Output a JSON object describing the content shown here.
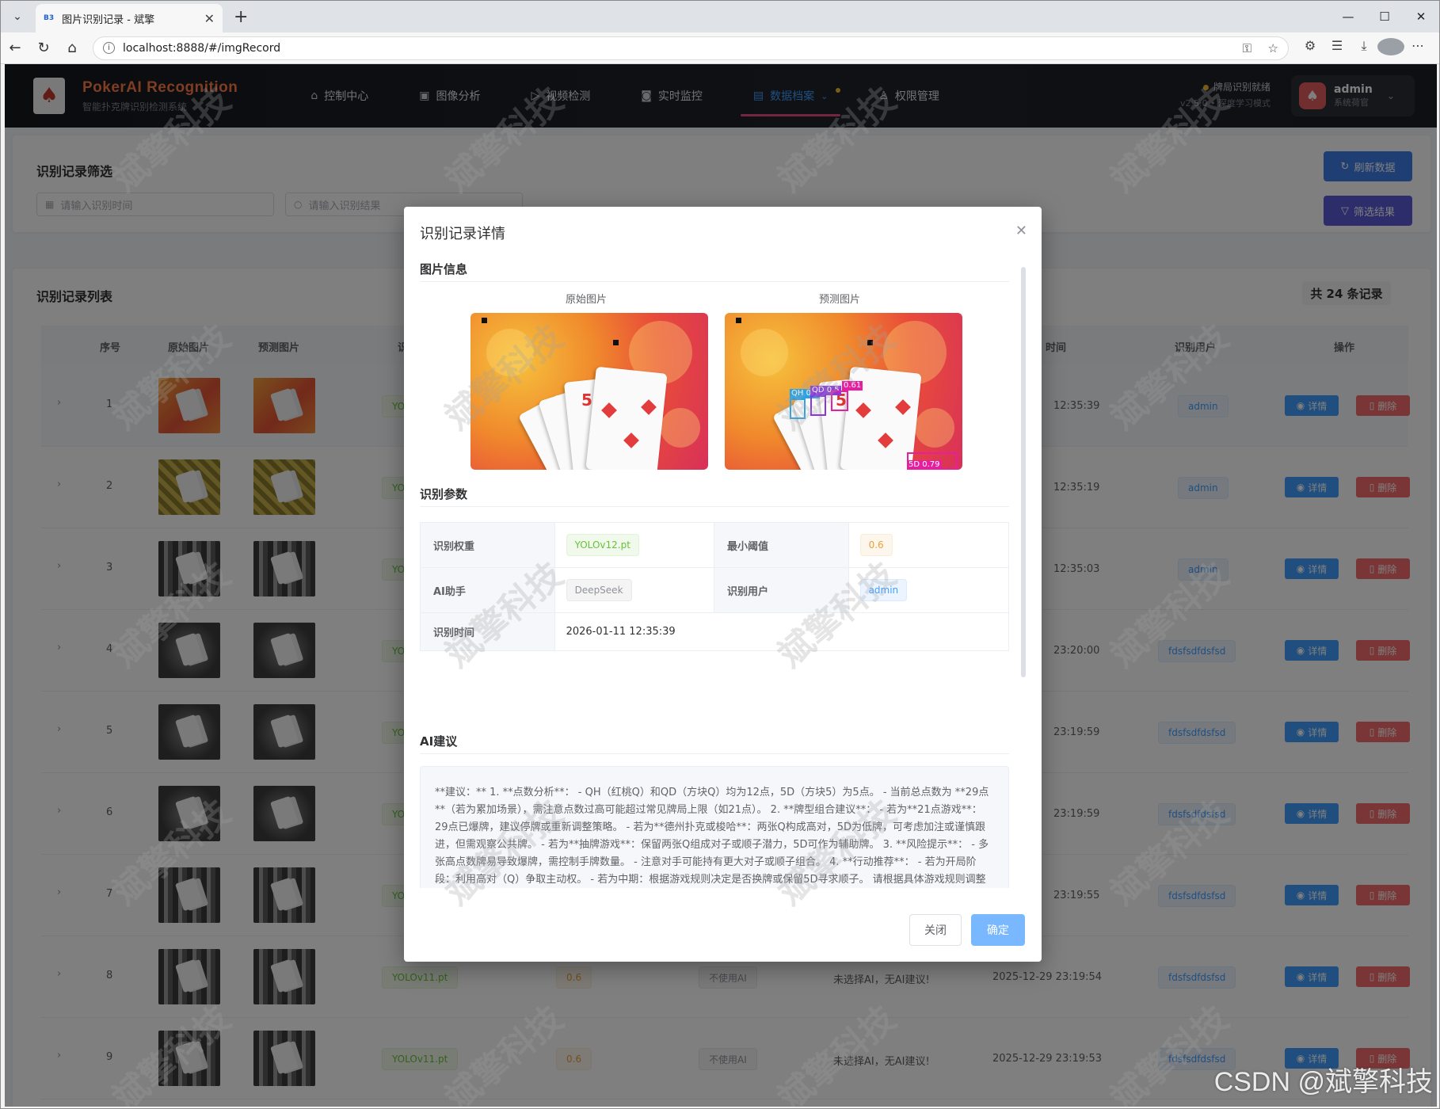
{
  "browser": {
    "tab_title": "图片识别记录 - 斌擎",
    "favicon_text": "B3",
    "url": "localhost:8888/#/imgRecord",
    "window_controls": [
      "minimize-icon",
      "maximize-icon",
      "close-icon"
    ]
  },
  "header": {
    "brand_title": "PokerAI Recognition",
    "brand_subtitle": "智能扑克牌识别检测系统",
    "nav": [
      {
        "label": "控制中心",
        "icon": "home-icon"
      },
      {
        "label": "图像分析",
        "icon": "image-icon"
      },
      {
        "label": "视频检测",
        "icon": "play-icon"
      },
      {
        "label": "实时监控",
        "icon": "camera-icon"
      },
      {
        "label": "数据档案",
        "icon": "document-icon",
        "active": true
      },
      {
        "label": "权限管理",
        "icon": "user-icon"
      }
    ],
    "status_text": "牌局识别就绪",
    "version_text": "v2.5.0 • 深度学习模式",
    "user_name": "admin",
    "user_role": "系统荷官"
  },
  "filter": {
    "title": "识别记录筛选",
    "time_placeholder": "请输入识别时间",
    "result_placeholder": "请输入识别结果",
    "refresh_label": "刷新数据",
    "filter_label": "筛选结果"
  },
  "list": {
    "title": "识别记录列表",
    "count_label": "共 24 条记录",
    "headers": [
      "序号",
      "原始图片",
      "预测图片",
      "识别",
      "时间",
      "识别用户",
      "操作"
    ],
    "detail_label": "详情",
    "delete_label": "删除",
    "rows": [
      {
        "index": "1",
        "weight": "YOLO",
        "time": "12:35:39",
        "user": "admin",
        "style": "warm"
      },
      {
        "index": "2",
        "weight": "YOLO",
        "time": "12:35:19",
        "user": "admin",
        "style": "olive"
      },
      {
        "index": "3",
        "weight": "YOLO",
        "time": "12:35:03",
        "user": "admin",
        "style": "gray"
      },
      {
        "index": "4",
        "weight": "YOLO",
        "time": "23:20:00",
        "user": "fdsfsdfdsfsd",
        "style": "dark"
      },
      {
        "index": "5",
        "weight": "YOLO",
        "time": "23:19:59",
        "user": "fdsfsdfdsfsd",
        "style": "dark"
      },
      {
        "index": "6",
        "weight": "YOLO",
        "time": "23:19:59",
        "user": "fdsfsdfdsfsd",
        "style": "dark"
      },
      {
        "index": "7",
        "weight": "YOLO",
        "time": "23:19:55",
        "user": "fdsfsdfdsfsd",
        "style": "gray"
      },
      {
        "index": "8",
        "weight": "YOLOv11.pt",
        "conf": "0.6",
        "ai": "不使用AI",
        "advice": "未选择AI，无AI建议!",
        "time": "2025-12-29 23:19:54",
        "user": "fdsfsdfdsfsd",
        "style": "gray"
      },
      {
        "index": "9",
        "weight": "YOLOv11.pt",
        "conf": "0.6",
        "ai": "不使用AI",
        "advice": "未选择AI，无AI建议!",
        "time": "2025-12-29 23:19:53",
        "user": "fdsfsdfdsfsd",
        "style": "gray"
      }
    ]
  },
  "dialog": {
    "title": "识别记录详情",
    "section_image": "图片信息",
    "original_caption": "原始图片",
    "predicted_caption": "预测图片",
    "detections": [
      {
        "label": "5D 0.79",
        "color": "#e81ea0"
      },
      {
        "label": "QH 0.5",
        "color": "#27a4e8"
      },
      {
        "label": "QD 0.5",
        "color": "#8a35e0"
      },
      {
        "label": "0.61",
        "color": "#e81ea0"
      }
    ],
    "section_params": "识别参数",
    "params": {
      "weight_label": "识别权重",
      "weight_value": "YOLOv12.pt",
      "conf_label": "最小阈值",
      "conf_value": "0.6",
      "ai_label": "AI助手",
      "ai_value": "DeepSeek",
      "user_label": "识别用户",
      "user_value": "admin",
      "time_label": "识别时间",
      "time_value": "2026-01-11 12:35:39"
    },
    "section_ai": "AI建议",
    "advice_text": "**建议：** 1. **点数分析**： - QH（红桃Q）和QD（方块Q）均为12点，5D（方块5）为5点。 - 当前总点数为 **29点**（若为累加场景），需注意点数过高可能超过常见牌局上限（如21点）。 2. **牌型组合建议**： - 若为**21点游戏**：29点已爆牌，建议停牌或重新调整策略。 - 若为**德州扑克或梭哈**：两张Q构成高对，5D为低牌，可考虑加注或谨慎跟进，但需观察公共牌。 - 若为**抽牌游戏**：保留两张Q组成对子或顺子潜力，5D可作为辅助牌。 3. **风险提示**： - 多张高点数牌易导致爆牌，需控制手牌数量。 - 注意对手可能持有更大对子或顺子组合。 4. **行动推荐**： - 若为开局阶段：利用高对（Q）争取主动权。 - 若为中期：根据游戏规则决定是否换牌或保留5D寻求顺子。 请根据具体游戏规则调整策略。",
    "close_label": "关闭",
    "ok_label": "确定"
  },
  "watermark_text": "斌擎科技",
  "csdn_text": "CSDN @斌擎科技"
}
